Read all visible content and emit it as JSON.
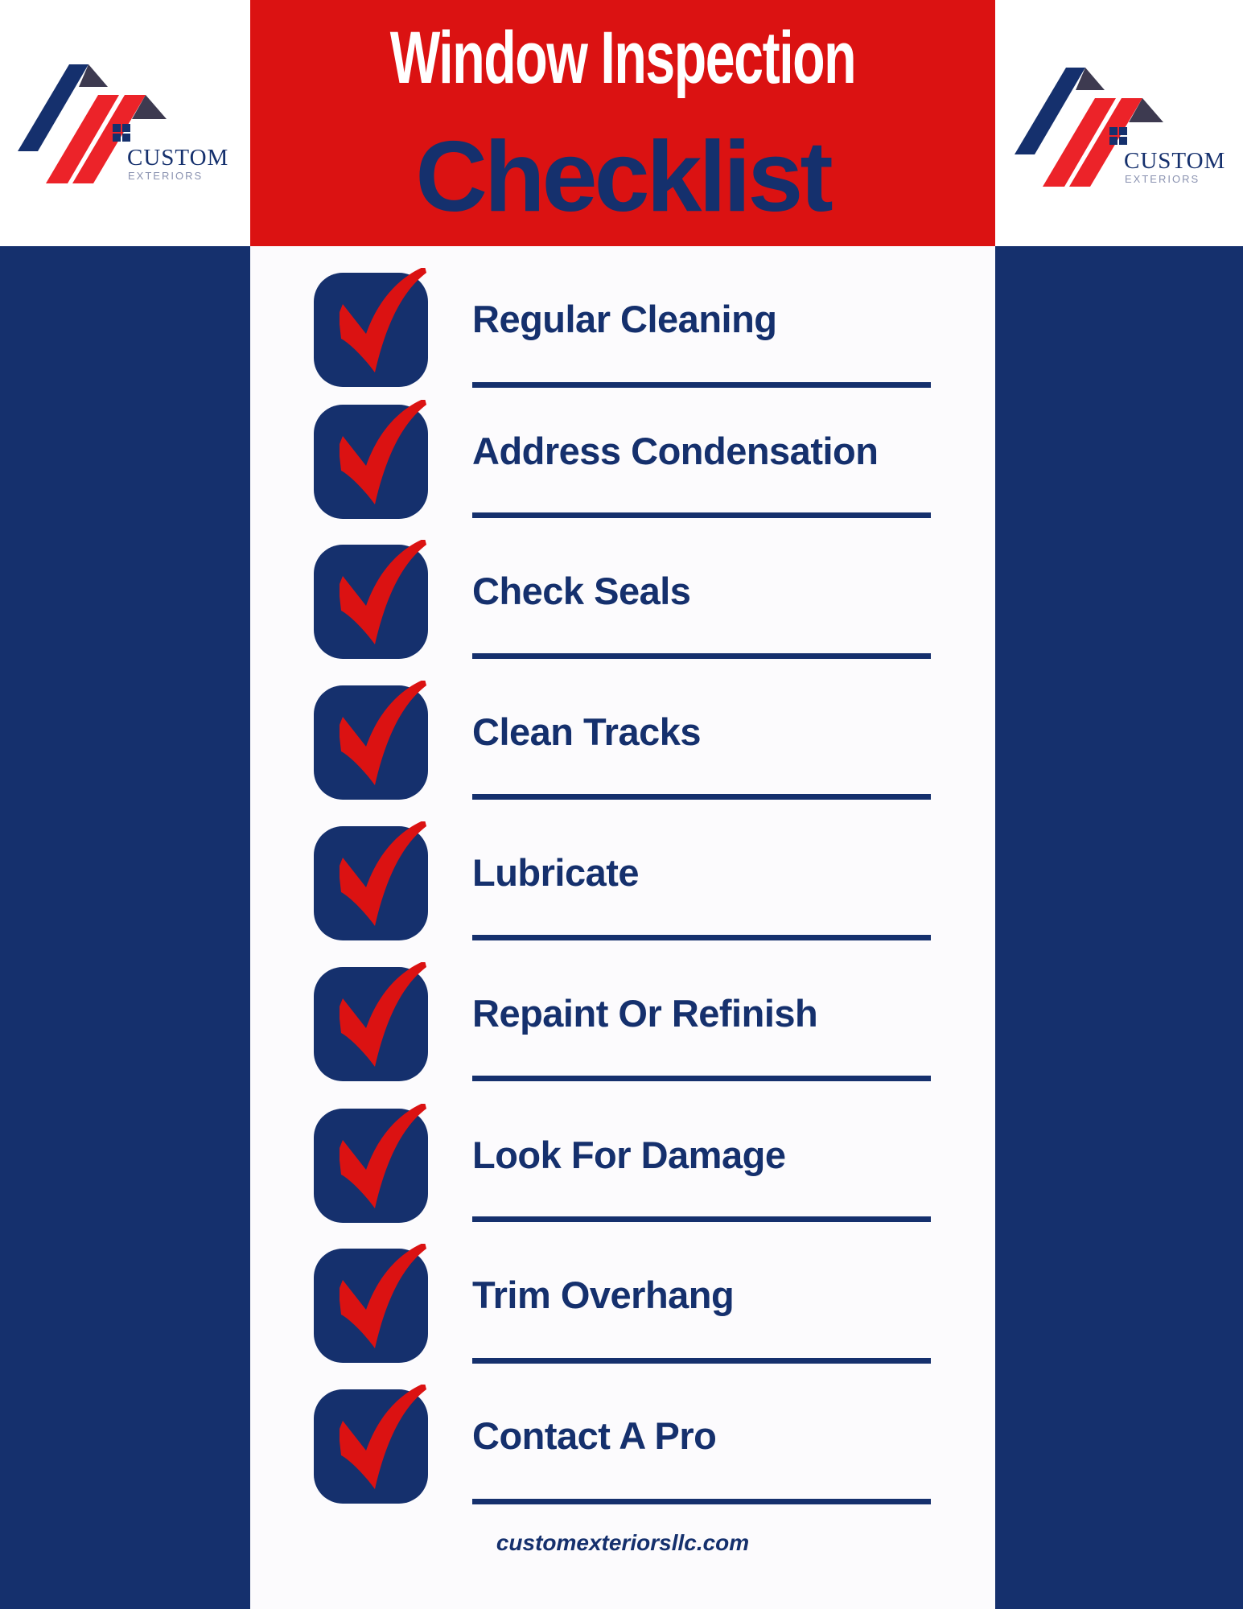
{
  "header": {
    "title": "Window Inspection",
    "subtitle": "Checklist"
  },
  "logo": {
    "name": "CUSTOM",
    "tagline": "EXTERIORS"
  },
  "checklist": {
    "items": [
      {
        "label": "Regular Cleaning",
        "checked": true
      },
      {
        "label": "Address Condensation",
        "checked": true
      },
      {
        "label": "Check Seals",
        "checked": true
      },
      {
        "label": "Clean Tracks",
        "checked": true
      },
      {
        "label": "Lubricate",
        "checked": true
      },
      {
        "label": "Repaint Or Refinish",
        "checked": true
      },
      {
        "label": "Look For Damage",
        "checked": true
      },
      {
        "label": "Trim Overhang",
        "checked": true
      },
      {
        "label": "Contact A Pro",
        "checked": true
      }
    ]
  },
  "footer": {
    "url": "customexteriorsllc.com"
  },
  "colors": {
    "brand_red": "#db1212",
    "brand_navy": "#15306d",
    "background": "#fcfbfd"
  }
}
